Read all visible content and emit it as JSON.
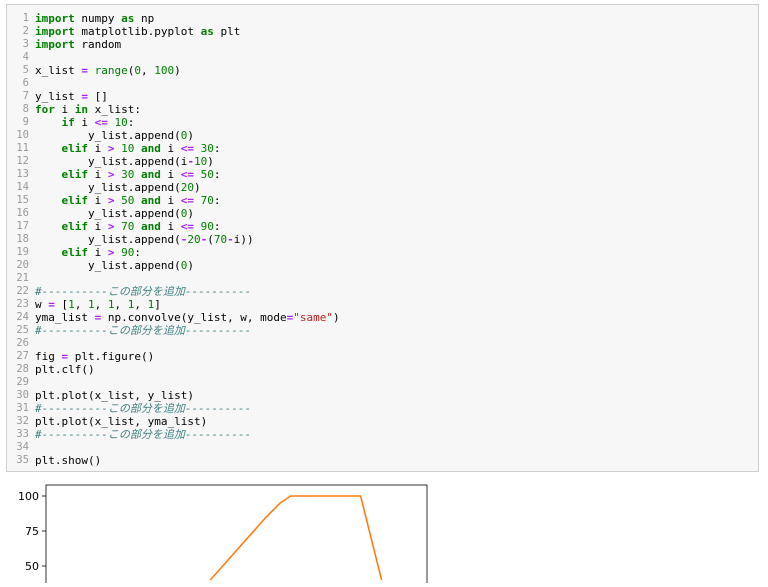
{
  "code_lines": [
    [
      {
        "t": "import",
        "c": "kw"
      },
      {
        "t": " numpy "
      },
      {
        "t": "as",
        "c": "kw"
      },
      {
        "t": " np"
      }
    ],
    [
      {
        "t": "import",
        "c": "kw"
      },
      {
        "t": " matplotlib.pyplot "
      },
      {
        "t": "as",
        "c": "kw"
      },
      {
        "t": " plt"
      }
    ],
    [
      {
        "t": "import",
        "c": "kw"
      },
      {
        "t": " random"
      }
    ],
    [],
    [
      {
        "t": "x_list "
      },
      {
        "t": "=",
        "c": "op"
      },
      {
        "t": " "
      },
      {
        "t": "range",
        "c": "builtin"
      },
      {
        "t": "("
      },
      {
        "t": "0",
        "c": "num"
      },
      {
        "t": ", "
      },
      {
        "t": "100",
        "c": "num"
      },
      {
        "t": ")"
      }
    ],
    [],
    [
      {
        "t": "y_list "
      },
      {
        "t": "=",
        "c": "op"
      },
      {
        "t": " []"
      }
    ],
    [
      {
        "t": "for",
        "c": "kw"
      },
      {
        "t": " i "
      },
      {
        "t": "in",
        "c": "kw"
      },
      {
        "t": " x_list:"
      }
    ],
    [
      {
        "t": "    "
      },
      {
        "t": "if",
        "c": "kw"
      },
      {
        "t": " i "
      },
      {
        "t": "<=",
        "c": "op"
      },
      {
        "t": " "
      },
      {
        "t": "10",
        "c": "num"
      },
      {
        "t": ":"
      }
    ],
    [
      {
        "t": "        y_list.append("
      },
      {
        "t": "0",
        "c": "num"
      },
      {
        "t": ")"
      }
    ],
    [
      {
        "t": "    "
      },
      {
        "t": "elif",
        "c": "kw"
      },
      {
        "t": " i "
      },
      {
        "t": ">",
        "c": "op"
      },
      {
        "t": " "
      },
      {
        "t": "10",
        "c": "num"
      },
      {
        "t": " "
      },
      {
        "t": "and",
        "c": "kw"
      },
      {
        "t": " i "
      },
      {
        "t": "<=",
        "c": "op"
      },
      {
        "t": " "
      },
      {
        "t": "30",
        "c": "num"
      },
      {
        "t": ":"
      }
    ],
    [
      {
        "t": "        y_list.append(i"
      },
      {
        "t": "-",
        "c": "op"
      },
      {
        "t": "10",
        "c": "num"
      },
      {
        "t": ")"
      }
    ],
    [
      {
        "t": "    "
      },
      {
        "t": "elif",
        "c": "kw"
      },
      {
        "t": " i "
      },
      {
        "t": ">",
        "c": "op"
      },
      {
        "t": " "
      },
      {
        "t": "30",
        "c": "num"
      },
      {
        "t": " "
      },
      {
        "t": "and",
        "c": "kw"
      },
      {
        "t": " i "
      },
      {
        "t": "<=",
        "c": "op"
      },
      {
        "t": " "
      },
      {
        "t": "50",
        "c": "num"
      },
      {
        "t": ":"
      }
    ],
    [
      {
        "t": "        y_list.append("
      },
      {
        "t": "20",
        "c": "num"
      },
      {
        "t": ")"
      }
    ],
    [
      {
        "t": "    "
      },
      {
        "t": "elif",
        "c": "kw"
      },
      {
        "t": " i "
      },
      {
        "t": ">",
        "c": "op"
      },
      {
        "t": " "
      },
      {
        "t": "50",
        "c": "num"
      },
      {
        "t": " "
      },
      {
        "t": "and",
        "c": "kw"
      },
      {
        "t": " i "
      },
      {
        "t": "<=",
        "c": "op"
      },
      {
        "t": " "
      },
      {
        "t": "70",
        "c": "num"
      },
      {
        "t": ":"
      }
    ],
    [
      {
        "t": "        y_list.append("
      },
      {
        "t": "0",
        "c": "num"
      },
      {
        "t": ")"
      }
    ],
    [
      {
        "t": "    "
      },
      {
        "t": "elif",
        "c": "kw"
      },
      {
        "t": " i "
      },
      {
        "t": ">",
        "c": "op"
      },
      {
        "t": " "
      },
      {
        "t": "70",
        "c": "num"
      },
      {
        "t": " "
      },
      {
        "t": "and",
        "c": "kw"
      },
      {
        "t": " i "
      },
      {
        "t": "<=",
        "c": "op"
      },
      {
        "t": " "
      },
      {
        "t": "90",
        "c": "num"
      },
      {
        "t": ":"
      }
    ],
    [
      {
        "t": "        y_list.append("
      },
      {
        "t": "-",
        "c": "op"
      },
      {
        "t": "20",
        "c": "num"
      },
      {
        "t": "-",
        "c": "op"
      },
      {
        "t": "("
      },
      {
        "t": "70",
        "c": "num"
      },
      {
        "t": "-",
        "c": "op"
      },
      {
        "t": "i))"
      }
    ],
    [
      {
        "t": "    "
      },
      {
        "t": "elif",
        "c": "kw"
      },
      {
        "t": " i "
      },
      {
        "t": ">",
        "c": "op"
      },
      {
        "t": " "
      },
      {
        "t": "90",
        "c": "num"
      },
      {
        "t": ":"
      }
    ],
    [
      {
        "t": "        y_list.append("
      },
      {
        "t": "0",
        "c": "num"
      },
      {
        "t": ")"
      }
    ],
    [],
    [
      {
        "t": "#----------この部分を追加----------",
        "c": "cm"
      }
    ],
    [
      {
        "t": "w "
      },
      {
        "t": "=",
        "c": "op"
      },
      {
        "t": " ["
      },
      {
        "t": "1",
        "c": "num"
      },
      {
        "t": ", "
      },
      {
        "t": "1",
        "c": "num"
      },
      {
        "t": ", "
      },
      {
        "t": "1",
        "c": "num"
      },
      {
        "t": ", "
      },
      {
        "t": "1",
        "c": "num"
      },
      {
        "t": ", "
      },
      {
        "t": "1",
        "c": "num"
      },
      {
        "t": "]"
      }
    ],
    [
      {
        "t": "yma_list "
      },
      {
        "t": "=",
        "c": "op"
      },
      {
        "t": " np.convolve(y_list, w, mode"
      },
      {
        "t": "=",
        "c": "op"
      },
      {
        "t": "\"same\"",
        "c": "str"
      },
      {
        "t": ")"
      }
    ],
    [
      {
        "t": "#----------この部分を追加----------",
        "c": "cm"
      }
    ],
    [],
    [
      {
        "t": "fig "
      },
      {
        "t": "=",
        "c": "op"
      },
      {
        "t": " plt.figure()"
      }
    ],
    [
      {
        "t": "plt.clf()"
      }
    ],
    [],
    [
      {
        "t": "plt.plot(x_list, y_list)"
      }
    ],
    [
      {
        "t": "#----------この部分を追加----------",
        "c": "cm"
      }
    ],
    [
      {
        "t": "plt.plot(x_list, yma_list)"
      }
    ],
    [
      {
        "t": "#----------この部分を追加----------",
        "c": "cm"
      }
    ],
    [],
    [
      {
        "t": "plt.show()"
      }
    ]
  ],
  "chart_data": {
    "type": "line",
    "ytick_labels": [
      "100",
      "75",
      "50"
    ],
    "ylim_visible": [
      40,
      108
    ],
    "xlim": [
      -5,
      104
    ],
    "series": [
      {
        "color": "#ff7f0e",
        "x": [
          42,
          58,
          62,
          65,
          68,
          82,
          85,
          86,
          91
        ],
        "y": [
          40,
          85,
          95,
          100,
          100,
          100,
          100,
          90,
          40
        ]
      }
    ]
  }
}
